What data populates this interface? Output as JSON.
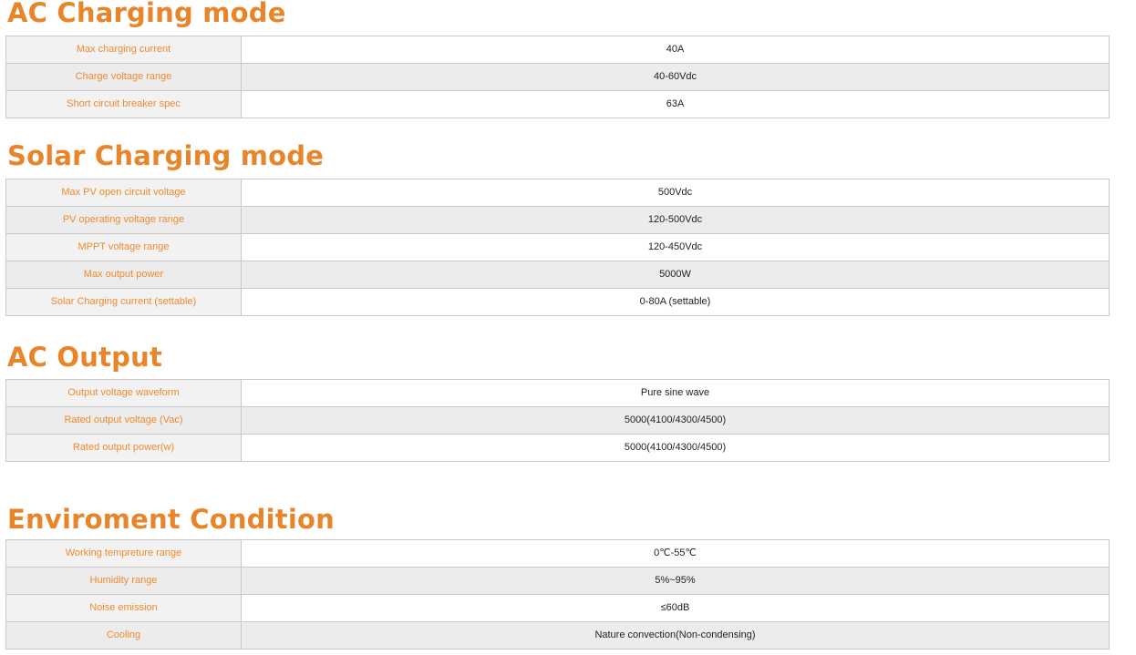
{
  "sections": [
    {
      "title": "AC Charging mode",
      "rows": [
        {
          "label": "Max  charging current",
          "value": "40A"
        },
        {
          "label": "Charge voltage range",
          "value": "40-60Vdc"
        },
        {
          "label": "Short circuit breaker spec",
          "value": "63A"
        }
      ]
    },
    {
      "title": "Solar Charging mode",
      "rows": [
        {
          "label": "Max PV open circuit voltage",
          "value": "500Vdc"
        },
        {
          "label": "PV operating voltage range",
          "value": "120-500Vdc"
        },
        {
          "label": "MPPT voltage range",
          "value": "120-450Vdc"
        },
        {
          "label": "Max output power",
          "value": "5000W"
        },
        {
          "label": "Solar Charging current (settable)",
          "value": "0-80A (settable)"
        }
      ]
    },
    {
      "title": "AC Output",
      "rows": [
        {
          "label": "Output voltage waveform",
          "value": "Pure sine wave"
        },
        {
          "label": "Rated output voltage (Vac)",
          "value": "5000(4100/4300/4500)"
        },
        {
          "label": "Rated output power(w)",
          "value": "5000(4100/4300/4500)"
        }
      ]
    },
    {
      "title": "Enviroment Condition",
      "rows": [
        {
          "label": "Working tempreture range",
          "value": "0℃-55℃"
        },
        {
          "label": "Humidity range",
          "value": "5%~95%"
        },
        {
          "label": "Noise emission",
          "value": "≤60dB"
        },
        {
          "label": "Cooling",
          "value": "Nature convection(Non-condensing)"
        }
      ]
    }
  ],
  "colors": {
    "accent": "#e8852a",
    "label_text": "#ef8a2e",
    "border": "#c9c9c9",
    "stripe": "#ececec"
  }
}
